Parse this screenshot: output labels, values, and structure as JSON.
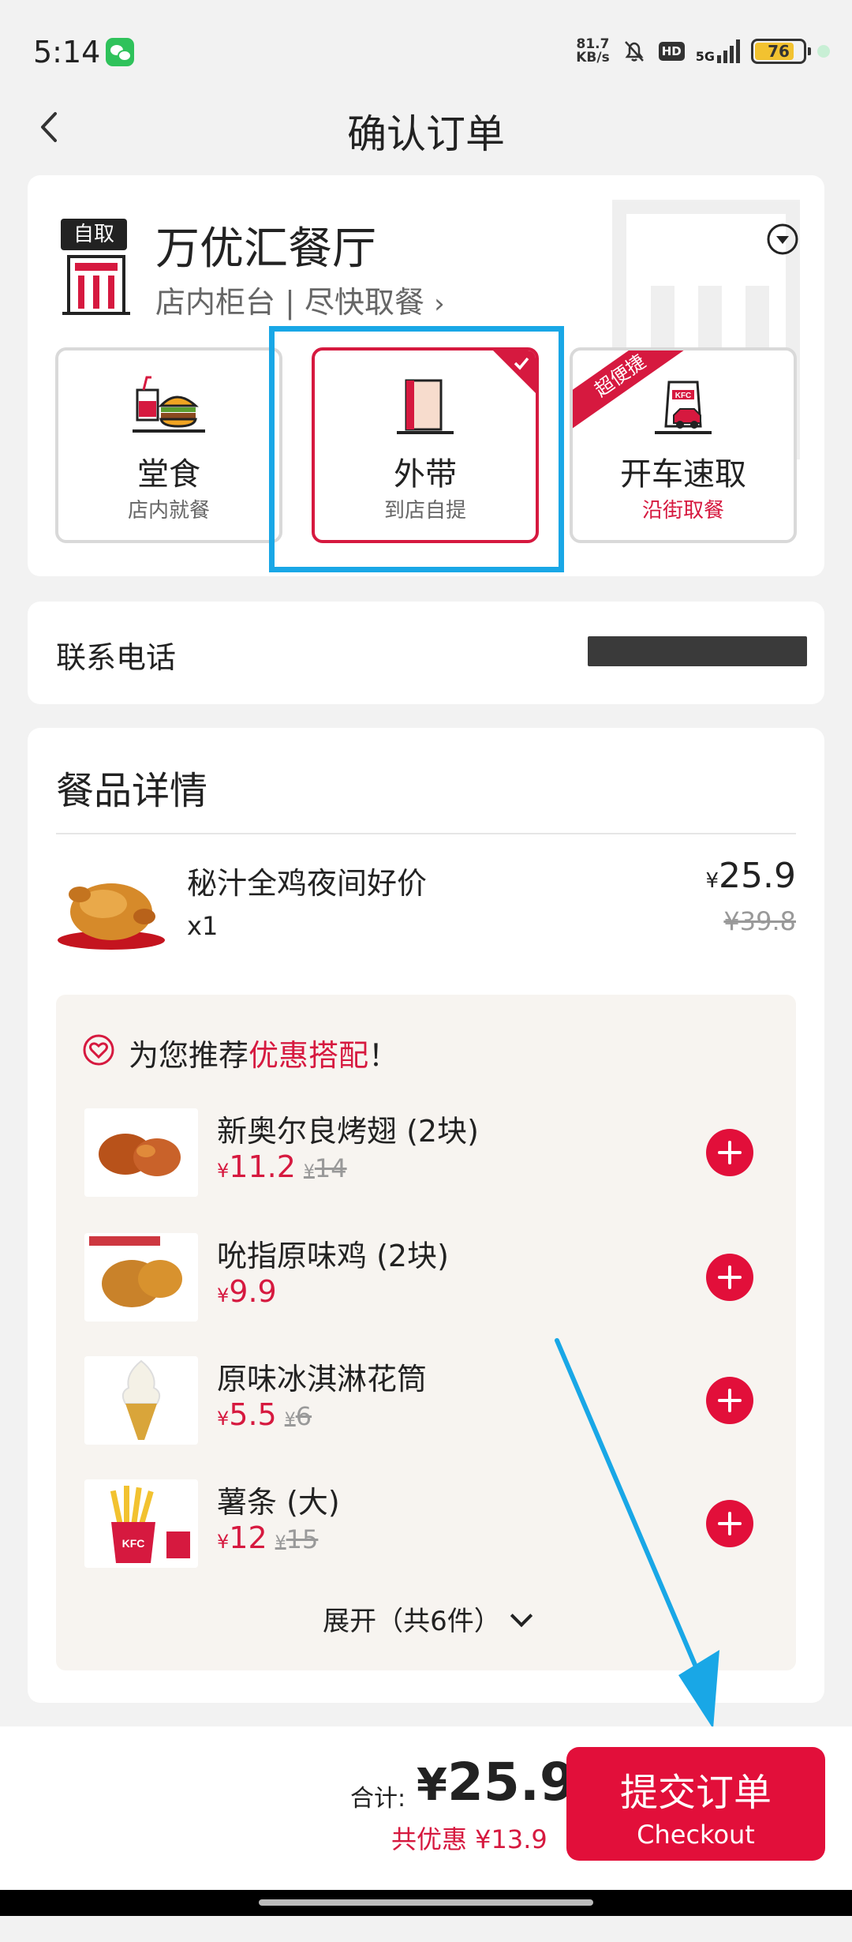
{
  "status_bar": {
    "time": "5:14",
    "net_speed_value": "81.7",
    "net_speed_unit": "KB/s",
    "hd": "HD",
    "signal": "5G",
    "battery": "76"
  },
  "header": {
    "title": "确认订单"
  },
  "store": {
    "pickup_tag": "自取",
    "name": "万优汇餐厅",
    "subtitle": "店内柜台 | 尽快取餐",
    "order_types": [
      {
        "label": "堂食",
        "sub": "店内就餐"
      },
      {
        "label": "外带",
        "sub": "到店自提"
      },
      {
        "label": "开车速取",
        "sub": "沿街取餐",
        "badge": "超便捷"
      }
    ]
  },
  "contact": {
    "label": "联系电话"
  },
  "meal": {
    "title": "餐品详情",
    "item": {
      "name": "秘汁全鸡夜间好价",
      "qty": "x1",
      "currency": "¥",
      "price": "25.9",
      "original": "¥39.8"
    },
    "recommend": {
      "prefix": "为您推荐",
      "highlight": "优惠搭配",
      "suffix": "！",
      "items": [
        {
          "name": "新奥尔良烤翅 (2块)",
          "price": "11.2",
          "original": "14"
        },
        {
          "name": "吮指原味鸡 (2块)",
          "price": "9.9",
          "original": ""
        },
        {
          "name": "原味冰淇淋花筒",
          "price": "5.5",
          "original": "6"
        },
        {
          "name": "薯条 (大)",
          "price": "12",
          "original": "15"
        }
      ],
      "currency": "¥",
      "expand": "展开（共6件）"
    }
  },
  "footer": {
    "total_label": "合计:",
    "total_currency": "¥",
    "total": "25.9",
    "discount": "共优惠 ¥13.9",
    "checkout_cn": "提交订单",
    "checkout_en": "Checkout"
  },
  "colors": {
    "brand_red": "#e20f3a",
    "annotation_blue": "#19a7e6"
  }
}
